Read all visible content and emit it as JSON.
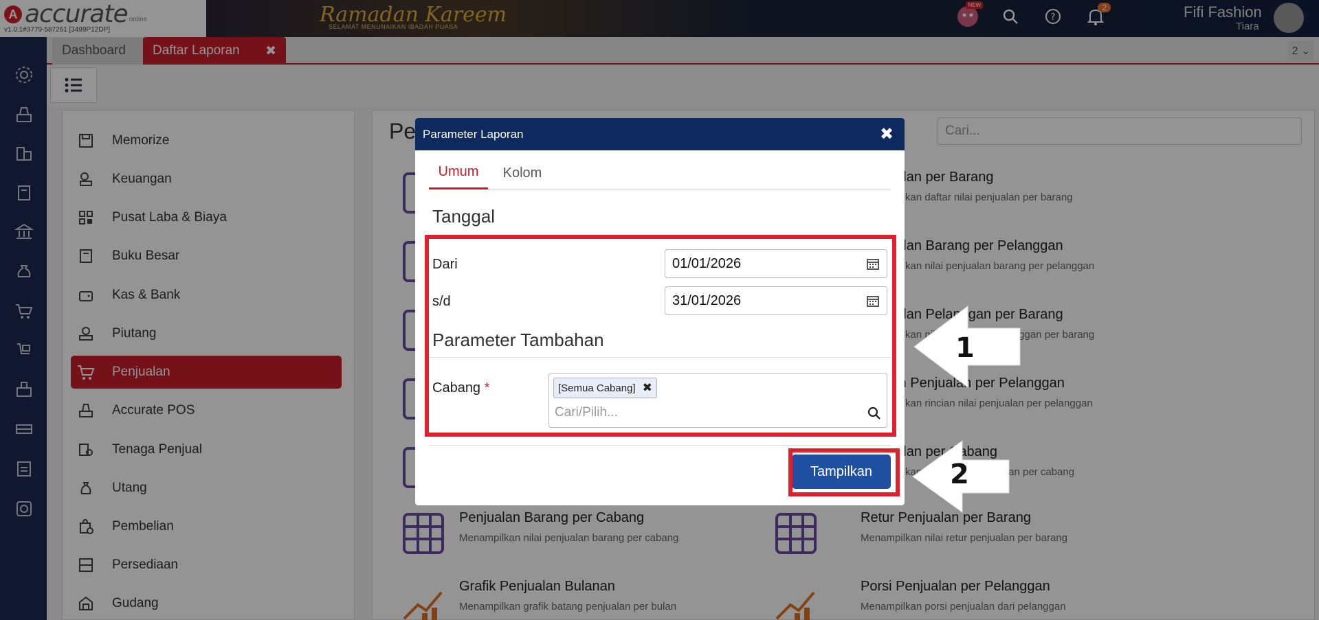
{
  "app": {
    "logo_letter": "A",
    "logo_text": "accurate",
    "logo_sub": "online",
    "version": "v1.0.1#3779-587261 [3499P12DP]",
    "banner_title": "Ramadan Kareem",
    "banner_sub": "SELAMAT MENUNAIKAN IBADAH PUASA",
    "new_badge": "NEW",
    "notif_count": "2",
    "user_name": "Fifi Fashion",
    "user_sub": "Tiara"
  },
  "tabs": {
    "dashboard": "Dashboard",
    "active": "Daftar Laporan",
    "close": "✖",
    "count": "2 ⌄"
  },
  "sidebar": {
    "items": [
      {
        "label": "Memorize",
        "icon": "save-icon"
      },
      {
        "label": "Keuangan",
        "icon": "money-icon"
      },
      {
        "label": "Pusat Laba & Biaya",
        "icon": "barcode-icon"
      },
      {
        "label": "Buku Besar",
        "icon": "book-icon"
      },
      {
        "label": "Kas & Bank",
        "icon": "wallet-icon"
      },
      {
        "label": "Piutang",
        "icon": "receivable-icon"
      },
      {
        "label": "Penjualan",
        "icon": "cart-icon"
      },
      {
        "label": "Accurate POS",
        "icon": "pos-icon"
      },
      {
        "label": "Tenaga Penjual",
        "icon": "salesperson-icon"
      },
      {
        "label": "Utang",
        "icon": "payable-icon"
      },
      {
        "label": "Pembelian",
        "icon": "purchase-icon"
      },
      {
        "label": "Persediaan",
        "icon": "inventory-icon"
      },
      {
        "label": "Gudang",
        "icon": "warehouse-icon"
      }
    ]
  },
  "main": {
    "title": "Pe",
    "search_placeholder": "Cari...",
    "reports_right": [
      {
        "title": "Penjualan per Barang",
        "desc": "Menampilkan daftar nilai penjualan per barang"
      },
      {
        "title": "Penjualan Barang per Pelanggan",
        "desc": "Menampilkan nilai penjualan barang per pelanggan"
      },
      {
        "title": "Penjualan Pelanggan per Barang",
        "desc": "Menampilkan nilai penjualan pelanggan per barang"
      },
      {
        "title": "Rincian Penjualan per Pelanggan",
        "desc": "Menampilkan rincian nilai penjualan per pelanggan"
      },
      {
        "title": "Penjualan per Cabang",
        "desc": "Menampilkan daftar nilai penjualan per cabang"
      },
      {
        "title": "Retur Penjualan per Barang",
        "desc": "Menampilkan nilai retur penjualan per barang"
      },
      {
        "title": "Porsi Penjualan per Pelanggan",
        "desc": "Menampilkan porsi penjualan dari pelanggan"
      }
    ],
    "reports_left": [
      {
        "title": "Penjualan Barang per Cabang",
        "desc": "Menampilkan nilai penjualan barang per cabang"
      },
      {
        "title": "Grafik Penjualan Bulanan",
        "desc": "Menampilkan grafik batang penjualan per bulan"
      }
    ]
  },
  "modal": {
    "title": "Parameter Laporan",
    "close": "✖",
    "tab_umum": "Umum",
    "tab_kolom": "Kolom",
    "section_tanggal": "Tanggal",
    "label_dari": "Dari",
    "value_dari": "01/01/2026",
    "label_sd": "s/d",
    "value_sd": "31/01/2026",
    "section_param": "Parameter Tambahan",
    "label_cabang": "Cabang",
    "required_mark": "*",
    "chip_cabang": "[Semua Cabang]",
    "chip_remove": "✖",
    "cabang_placeholder": "Cari/Pilih...",
    "button_tampilkan": "Tampilkan"
  },
  "annotations": {
    "arrow1": "1",
    "arrow2": "2",
    "highlight_color": "#e0202c"
  }
}
